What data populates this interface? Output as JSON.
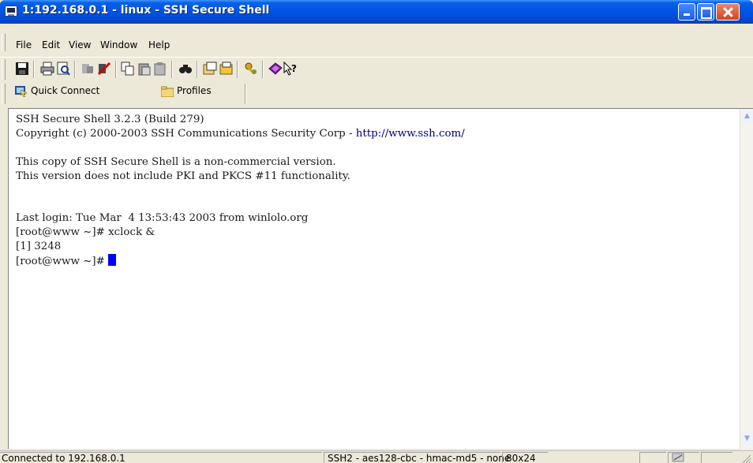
{
  "window": {
    "title": "1:192.168.0.1 - linux - SSH Secure Shell"
  },
  "menu": {
    "file": "File",
    "edit": "Edit",
    "view": "View",
    "window": "Window",
    "help": "Help"
  },
  "toolbar": {
    "icons": [
      "save-icon",
      "print-icon",
      "print-preview-icon",
      "quick-connect-icon",
      "disconnect-icon",
      "copy-icon",
      "paste-icon",
      "paste-clipboard-icon",
      "find-icon",
      "settings-icon",
      "profile-icon",
      "key-icon",
      "help-icon",
      "context-help-icon"
    ]
  },
  "quickbar": {
    "quick_connect": "Quick Connect",
    "profiles": "Profiles"
  },
  "terminal": {
    "lines": [
      "SSH Secure Shell 3.2.3 (Build 279)",
      "Copyright (c) 2000-2003 SSH Communications Security Corp - ",
      "",
      "This copy of SSH Secure Shell is a non-commercial version.",
      "This version does not include PKI and PKCS #11 functionality.",
      "",
      "",
      "Last login: Tue Mar  4 13:53:43 2003 from winlolo.org",
      "[root@www ~]# xclock &",
      "[1] 3248",
      "[root@www ~]# "
    ],
    "link": "http://www.ssh.com/"
  },
  "status": {
    "connection": "Connected to 192.168.0.1",
    "cipher": "SSH2 - aes128-cbc - hmac-md5 - none",
    "size": "80x24"
  },
  "colors": {
    "titlebar": "#0054e3",
    "cursor": "#0000ff",
    "link": "#00007c"
  }
}
